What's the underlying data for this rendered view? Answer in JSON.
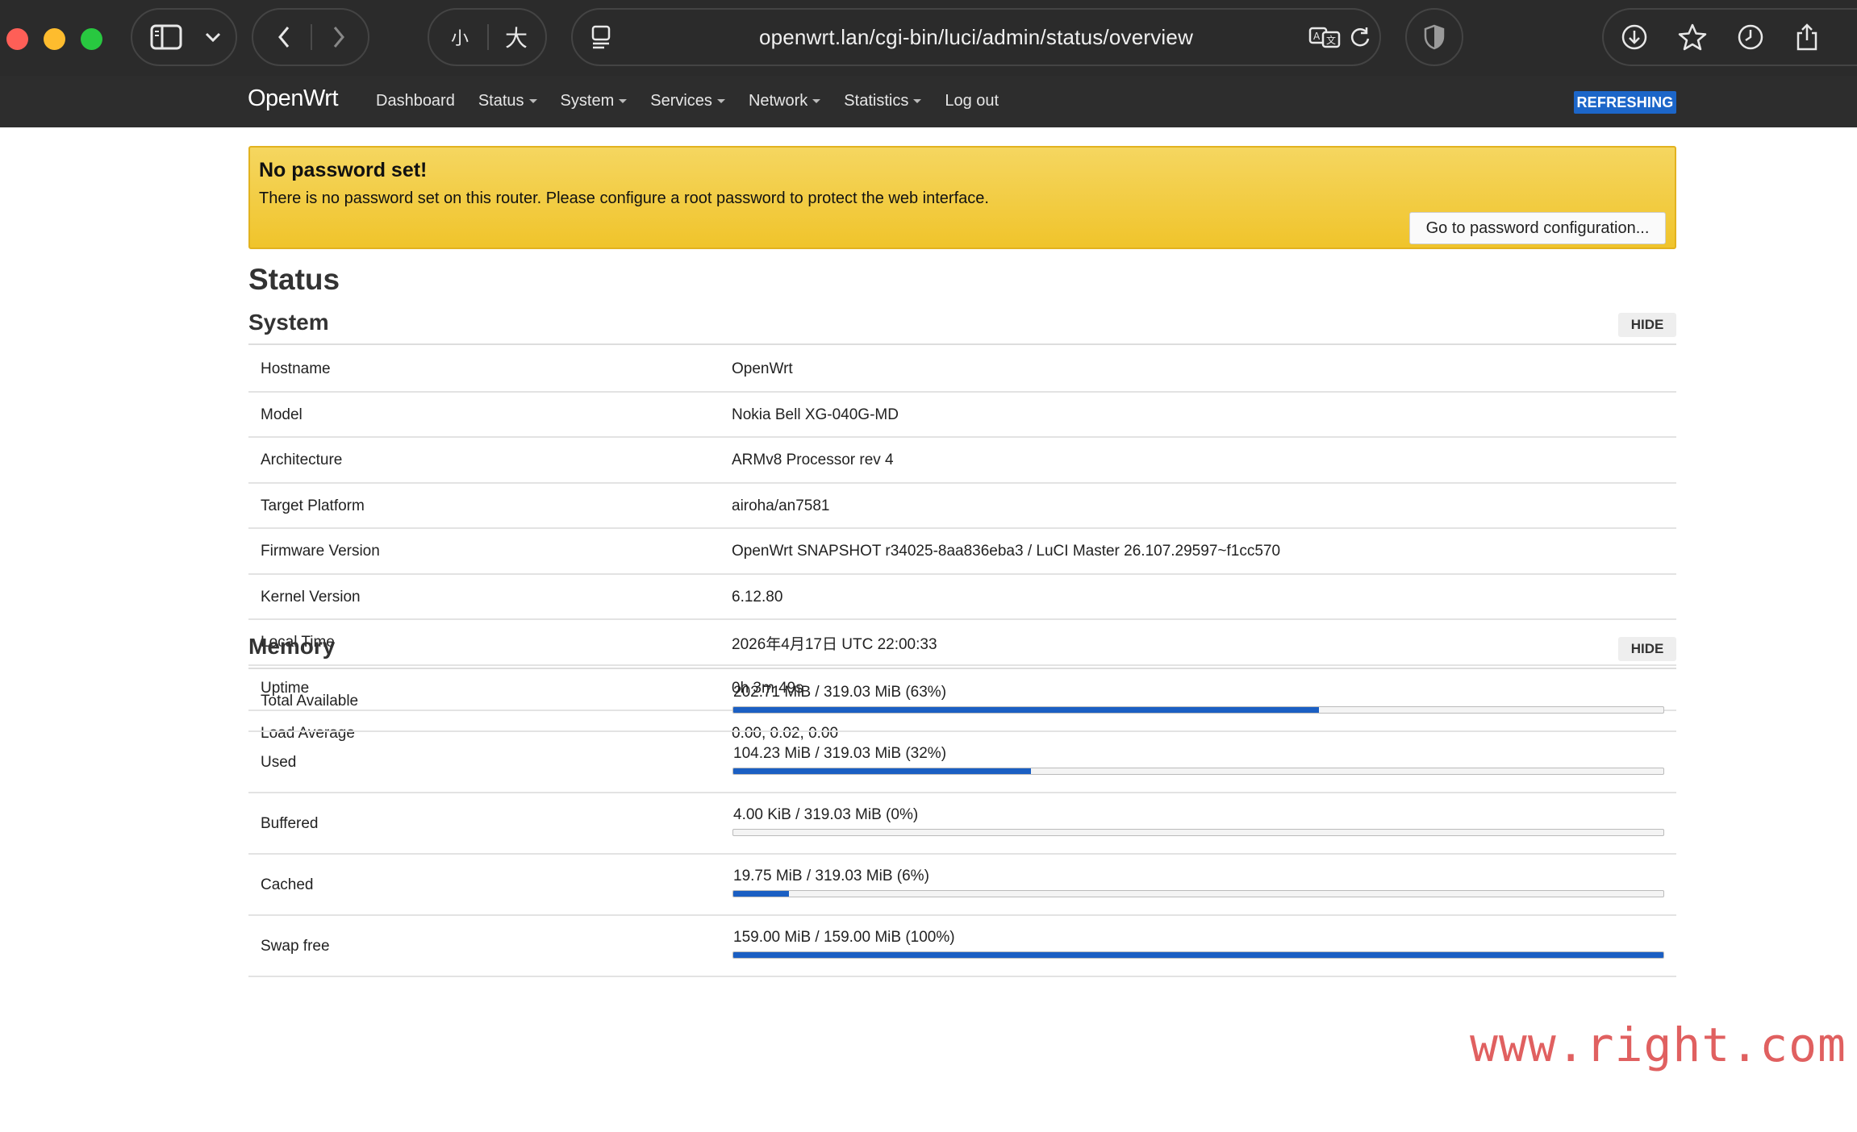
{
  "browser": {
    "url": "openwrt.lan/cgi-bin/luci/admin/status/overview",
    "zoom_small": "小",
    "zoom_large": "大"
  },
  "header": {
    "brand": "OpenWrt",
    "menu": [
      {
        "label": "Dashboard",
        "caret": false
      },
      {
        "label": "Status",
        "caret": true
      },
      {
        "label": "System",
        "caret": true
      },
      {
        "label": "Services",
        "caret": true
      },
      {
        "label": "Network",
        "caret": true
      },
      {
        "label": "Statistics",
        "caret": true
      },
      {
        "label": "Log out",
        "caret": false
      }
    ],
    "refresh_badge": "REFRESHING"
  },
  "alert": {
    "title": "No password set!",
    "text": "There is no password set on this router. Please configure a root password to protect the web interface.",
    "button": "Go to password configuration..."
  },
  "page_title": "Status",
  "system": {
    "title": "System",
    "hide": "HIDE",
    "rows": [
      {
        "key": "Hostname",
        "value": "OpenWrt"
      },
      {
        "key": "Model",
        "value": "Nokia Bell XG-040G-MD"
      },
      {
        "key": "Architecture",
        "value": "ARMv8 Processor rev 4"
      },
      {
        "key": "Target Platform",
        "value": "airoha/an7581"
      },
      {
        "key": "Firmware Version",
        "value": "OpenWrt SNAPSHOT r34025-8aa836eba3 / LuCI Master 26.107.29597~f1cc570"
      },
      {
        "key": "Kernel Version",
        "value": "6.12.80"
      },
      {
        "key": "Local Time",
        "value": "2026年4月17日 UTC 22:00:33"
      },
      {
        "key": "Uptime",
        "value": "0h 3m 49s"
      },
      {
        "key": "Load Average",
        "value": "0.00, 0.02, 0.00"
      }
    ]
  },
  "memory": {
    "title": "Memory",
    "hide": "HIDE",
    "rows": [
      {
        "key": "Total Available",
        "label": "202.71 MiB / 319.03 MiB (63%)",
        "percent": 63
      },
      {
        "key": "Used",
        "label": "104.23 MiB / 319.03 MiB (32%)",
        "percent": 32
      },
      {
        "key": "Buffered",
        "label": "4.00 KiB / 319.03 MiB (0%)",
        "percent": 0
      },
      {
        "key": "Cached",
        "label": "19.75 MiB / 319.03 MiB (6%)",
        "percent": 6
      },
      {
        "key": "Swap free",
        "label": "159.00 MiB / 159.00 MiB (100%)",
        "percent": 100
      }
    ]
  },
  "colors": {
    "accent": "#1b5fc3",
    "badge": "#1c66c9",
    "alert": "#f0c42b",
    "header": "#2d2d2d"
  },
  "watermark": "www.right.com.cn"
}
